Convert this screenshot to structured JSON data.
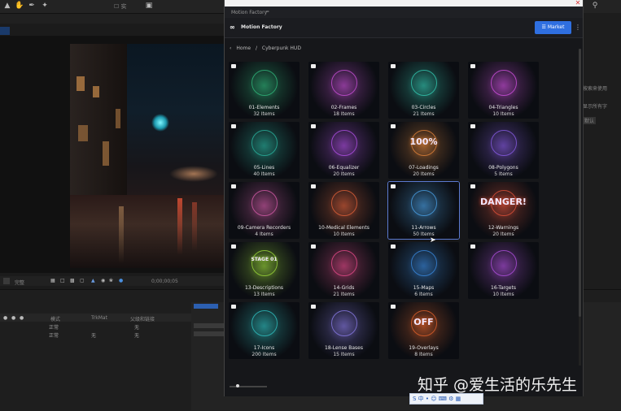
{
  "ae": {
    "toolbar_label": "☐ 实",
    "ctrl_zoom": "完整",
    "ctrl_time": "0;00;00;05",
    "tl_col1": "模式",
    "tl_col2": "TrkMat",
    "tl_col3": "父级和链接",
    "tl_row1_mode": "正常",
    "tl_row1_parent": "无",
    "tl_row2_mode": "正常",
    "tl_row2_trk": "无",
    "tl_row2_parent": "无",
    "rp_line1": "按索来使用",
    "rp_line2": "显示所有字",
    "rp_line3": "默认"
  },
  "window": {
    "title": "Motion Factory",
    "title_dash": "=",
    "close": "✕"
  },
  "header": {
    "brand": "Motion Factory",
    "market_label": "☰ Market",
    "menu": "⋮"
  },
  "breadcrumb": {
    "back": "‹",
    "home": "Home",
    "sep": "/",
    "current": "Cyberpunk HUD"
  },
  "cards": [
    {
      "name": "01-Elements",
      "count": "32 Items",
      "color": "#2fb77a"
    },
    {
      "name": "02-Frames",
      "count": "18 Items",
      "color": "#c94fd8"
    },
    {
      "name": "03-Circles",
      "count": "21 Items",
      "color": "#33c9b2"
    },
    {
      "name": "04-Triangles",
      "count": "10 Items",
      "color": "#d04fe0"
    },
    {
      "name": "05-Lines",
      "count": "40 Items",
      "color": "#29b39e"
    },
    {
      "name": "06-Equalizer",
      "count": "20 Items",
      "color": "#b24fe6"
    },
    {
      "name": "07-Loadings",
      "count": "20 Items",
      "color": "#e0823a"
    },
    {
      "name": "08-Polygons",
      "count": "5 Items",
      "color": "#8a5be6"
    },
    {
      "name": "09-Camera Recorders",
      "count": "4 Items",
      "color": "#d45aa8"
    },
    {
      "name": "10-Medical Elements",
      "count": "10 Items",
      "color": "#e0603a"
    },
    {
      "name": "11-Arrows",
      "count": "50 Items",
      "color": "#4aa0e6"
    },
    {
      "name": "12-Warnings",
      "count": "20 Items",
      "color": "#e0503a"
    },
    {
      "name": "13-Descriptions",
      "count": "13 Items",
      "color": "#9bd83a"
    },
    {
      "name": "14-Grids",
      "count": "21 Items",
      "color": "#e64a8a"
    },
    {
      "name": "15-Maps",
      "count": "6 Items",
      "color": "#3a8ae0"
    },
    {
      "name": "16-Targets",
      "count": "10 Items",
      "color": "#b24fe0"
    },
    {
      "name": "17-Icons",
      "count": "200 Items",
      "color": "#2fc0c0"
    },
    {
      "name": "18-Lense Bases",
      "count": "15 Items",
      "color": "#8a7ae6"
    },
    {
      "name": "19-Overlays",
      "count": "8 Items",
      "color": "#e0602a"
    }
  ],
  "overlay_texts": {
    "card_07": "100%",
    "card_12": "DANGER!",
    "card_13": "STAGE 01",
    "card_19": "OFF"
  },
  "watermark": "知乎 @爱生活的乐先生",
  "ime_bar": "S 中 • ☺ ⌨ ⚙ ▦"
}
